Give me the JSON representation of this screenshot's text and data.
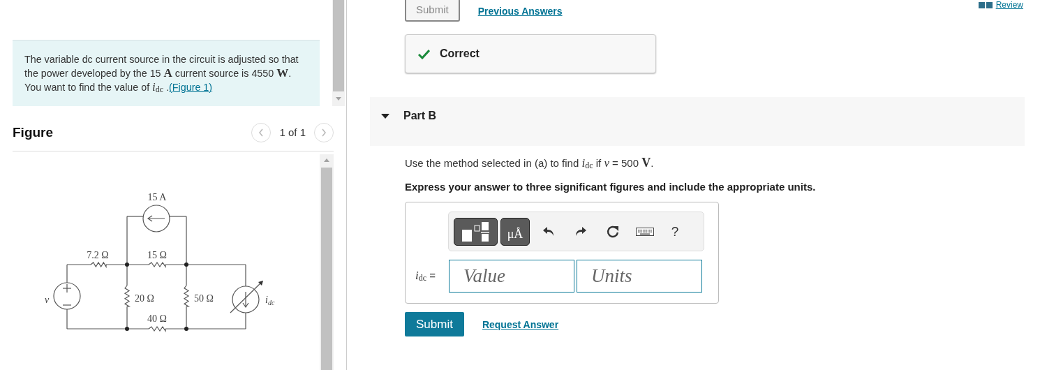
{
  "problem": {
    "text": "The variable dc current source in the circuit is adjusted so that the power developed by the 15 **A** current source is 4550 **W**. You want to find the value of *i*$_{dc}$ .",
    "link": "(Figure 1)"
  },
  "figure": {
    "title": "Figure",
    "pager": "1 of 1",
    "labels": [
      {
        "text": "15 A"
      },
      {
        "text": "7.2 Ω"
      },
      {
        "text": "15 Ω"
      },
      {
        "text": "20 Ω"
      },
      {
        "text": "50 Ω"
      },
      {
        "text": "40 Ω"
      },
      {
        "text": "v"
      },
      {
        "text": "i",
        "sub": "dc"
      }
    ]
  },
  "review": "Review",
  "previous": {
    "submit": "Submit",
    "submit_disabled": true,
    "link": "Previous Answers"
  },
  "feedback": {
    "correct": true,
    "text": "Correct"
  },
  "part": {
    "title": "Part B",
    "expanded": true,
    "question": "Use the method selected in (a) to find *i*$_{dc}$  if *v* = 500 **V**.",
    "instruction": "Express your answer to three significant figures and include the appropriate units.",
    "toolbar": [
      {
        "kind": "templates"
      },
      {
        "kind": "units",
        "label": "μÅ"
      },
      {
        "kind": "undo"
      },
      {
        "kind": "redo"
      },
      {
        "kind": "reset"
      },
      {
        "kind": "keyboard"
      },
      {
        "kind": "help",
        "label": "?"
      }
    ],
    "answer_label": "*i*$_{dc}$ =",
    "fields": [
      {
        "placeholder": "Value"
      },
      {
        "placeholder": "Units"
      }
    ],
    "submit": "Submit",
    "request": "Request Answer"
  }
}
